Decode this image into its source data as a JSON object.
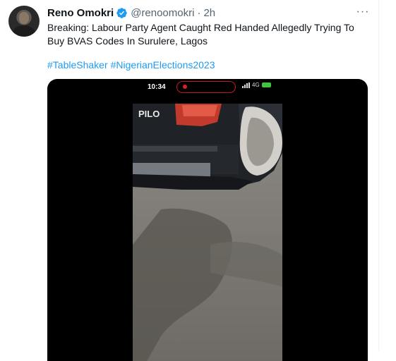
{
  "author": {
    "name": "Reno Omokri",
    "handle": "@renoomokri",
    "separator": "·",
    "time": "2h",
    "verified_icon": "verified-badge-icon"
  },
  "more_label": "···",
  "tweet": {
    "text": "Breaking: Labour Party Agent Caught Red Handed Allegedly Trying To Buy BVAS Codes In Surulere, Lagos",
    "hashtags": [
      "#TableShaker",
      "#NigerianElections2023"
    ]
  },
  "media": {
    "status_time": "10:34",
    "network": "4G",
    "plate_text": "PILO"
  },
  "colors": {
    "link": "#1d9bf0",
    "secondary": "#536471",
    "verified": "#1d9bf0",
    "recording": "#e02020"
  }
}
